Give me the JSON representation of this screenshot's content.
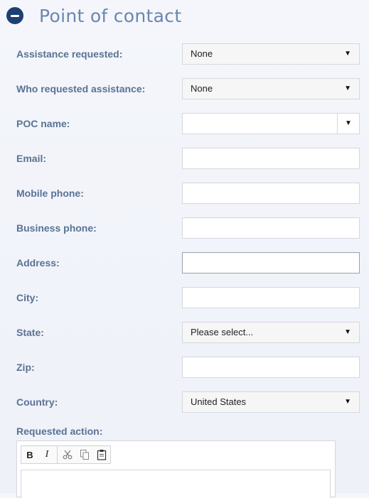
{
  "section": {
    "title": "Point of contact",
    "collapse_icon": "minus-circle-icon"
  },
  "form": {
    "assistance_requested": {
      "label": "Assistance requested:",
      "value": "None"
    },
    "who_requested": {
      "label": "Who requested assistance:",
      "value": "None"
    },
    "poc_name": {
      "label": "POC name:",
      "value": ""
    },
    "email": {
      "label": "Email:",
      "value": ""
    },
    "mobile_phone": {
      "label": "Mobile phone:",
      "value": ""
    },
    "business_phone": {
      "label": "Business phone:",
      "value": ""
    },
    "address": {
      "label": "Address:",
      "value": ""
    },
    "city": {
      "label": "City:",
      "value": ""
    },
    "state": {
      "label": "State:",
      "value": "Please select..."
    },
    "zip": {
      "label": "Zip:",
      "value": ""
    },
    "country": {
      "label": "Country:",
      "value": "United States"
    },
    "requested_action": {
      "label": "Requested action:"
    }
  },
  "editor_toolbar": {
    "bold": "B",
    "italic": "I",
    "icons": [
      "bold-icon",
      "italic-icon",
      "cut-icon",
      "copy-icon",
      "paste-icon"
    ]
  },
  "colors": {
    "accent": "#1e3f73",
    "title": "#6a86b0",
    "label": "#5a7294"
  }
}
